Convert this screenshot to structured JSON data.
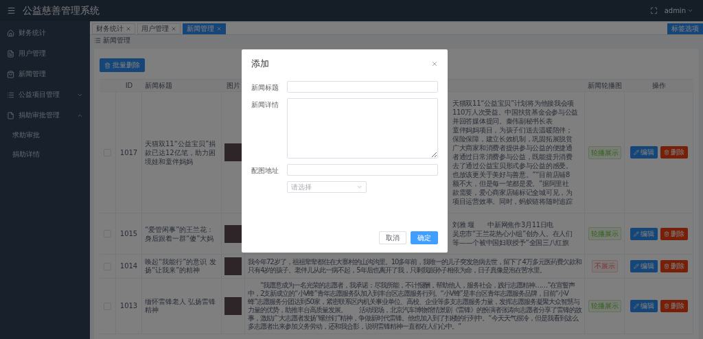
{
  "header": {
    "title": "公益慈善管理系统",
    "user": "admin"
  },
  "sidebar": {
    "items": [
      {
        "kind": "link",
        "label": "财务统计"
      },
      {
        "kind": "link",
        "label": "用户管理"
      },
      {
        "kind": "link",
        "label": "新闻管理"
      },
      {
        "kind": "group",
        "label": "公益项目管理",
        "expanded": false
      },
      {
        "kind": "group",
        "label": "捐助审批管理",
        "expanded": true,
        "children": [
          {
            "label": "求助审批"
          },
          {
            "label": "捐助详情"
          }
        ]
      }
    ]
  },
  "tabs": [
    {
      "label": "财务统计",
      "selected": false
    },
    {
      "label": "用户管理",
      "selected": false
    },
    {
      "label": "新闻管理",
      "selected": true
    }
  ],
  "tab_options_button": "标签选项",
  "breadcrumb": "新闻管理",
  "bulk_delete_button": "批量删除",
  "table": {
    "columns": [
      "ID",
      "新闻标题",
      "图片",
      "新闻轮播图",
      "操作"
    ],
    "rows": [
      {
        "kind": "partial",
        "checked": false,
        "id": "1017",
        "title": "天猫双11“公益宝贝”捐款已达12亿笔，助力困境娃和童伴妈妈",
        "detail_lines": [
          "天猫双11“公益宝贝”计划将为他接我会项",
          "110万人次受益。中国扶贫基金会参与公益",
          "并回答媒体提问。秦伟副秘书长表",
          "童伴妈妈项目，为孩子们送去温暖陪伴；",
          "保险保障，建立长效机制，巩固拓展脱贫",
          "广大商家和消费者提供参与公益的便捷通",
          "者通过日常消费参与公益，既能提升消费",
          "去了通过公益宝贝形式参与公益的感受。",
          "也放该更关于美好与善意。”“目前店铺8",
          "额不大，但是每一笔都是爱。”据阿里社",
          "款需要，爱心商家店铺标记全城可见，为",
          "项目运营效率。同时，蚂蚁链将随时追踪"
        ],
        "shown": true,
        "status": "轮播展示",
        "edit": "编辑",
        "delete": "删除"
      },
      {
        "kind": "partial",
        "checked": false,
        "id": "1015",
        "title": "“爱管闲事”的王兰花：身后跟着一群“傻”大妈",
        "detail_lines": [
          "刘雅 堰　　中新网焦作3月11日电",
          "吴忠市“王兰花热心小组”创办人。在人们",
          "等——个被中国妇联授予“全国三八红旗"
        ],
        "shown": true,
        "status": "轮播展示",
        "edit": "编辑",
        "delete": "删除"
      },
      {
        "kind": "full",
        "checked": false,
        "id": "1014",
        "title": "唤起“我能行”的意识 发扬“让我来”的精神",
        "detail_lines": [
          "我今年72岁了，祖祖辈辈都住在大寨村的山沟沟里。10多年前，我唯一的儿子突发急病去世，留下了4万多元医药费欠款和只有4岁的孩子。老伴儿从此一病不起，5年后也离开了我，只剩我跟孙子相依为命，日子真像是泡在苦水里。"
        ],
        "shown": false,
        "status": "不展示",
        "edit": "编辑",
        "delete": "删除"
      },
      {
        "kind": "full",
        "checked": false,
        "id": "1013",
        "title": "缅怀雷锋老人 弘扬雷锋精神",
        "detail_lines": [
          "　　“我愿意成为一名光荣的志愿者，我承诺：尽我所能，不计报酬，帮助他人，服务社会，践行志愿精神……”在宣誓声中，2支新成立的“小V蜂”青年志愿服务队加入到丰台区志愿服务行列。“小V蜂”是丰台区青年志愿服务品牌，目前“小V蜂”志愿服务分团达到50家，紧密联系区内机关事业单位、高校、企业等多支志愿服务力量，发挥志愿服务凝聚大众智慧与力量的优势，助推丰台高质量发展。　　活动现场，北京汽车博物馆情景剧《雷锋》的扮演者张涛向志愿者分享了雷锋的故事，激励广大志愿者发扬“螺丝钉”精神，争做新时代雷锋。他也加入到了扫楼的行列中。“今天天气很冷，但是我看到这么多志愿者出来参加义务劳动，还和我合影，说明雷锋精神一直都在人们心中。”"
        ],
        "shown": true,
        "status": "轮播展示",
        "edit": "编辑",
        "delete": "删除"
      }
    ]
  },
  "dialog": {
    "title": "添加",
    "fields": [
      {
        "kind": "input",
        "label": "新闻标题"
      },
      {
        "kind": "textarea",
        "label": "新闻详情"
      },
      {
        "kind": "input",
        "label": "配图地址"
      },
      {
        "kind": "select",
        "placeholder": "请选择"
      }
    ],
    "buttons": [
      {
        "label": "取消",
        "primary": false
      },
      {
        "label": "确定",
        "primary": true
      }
    ]
  }
}
